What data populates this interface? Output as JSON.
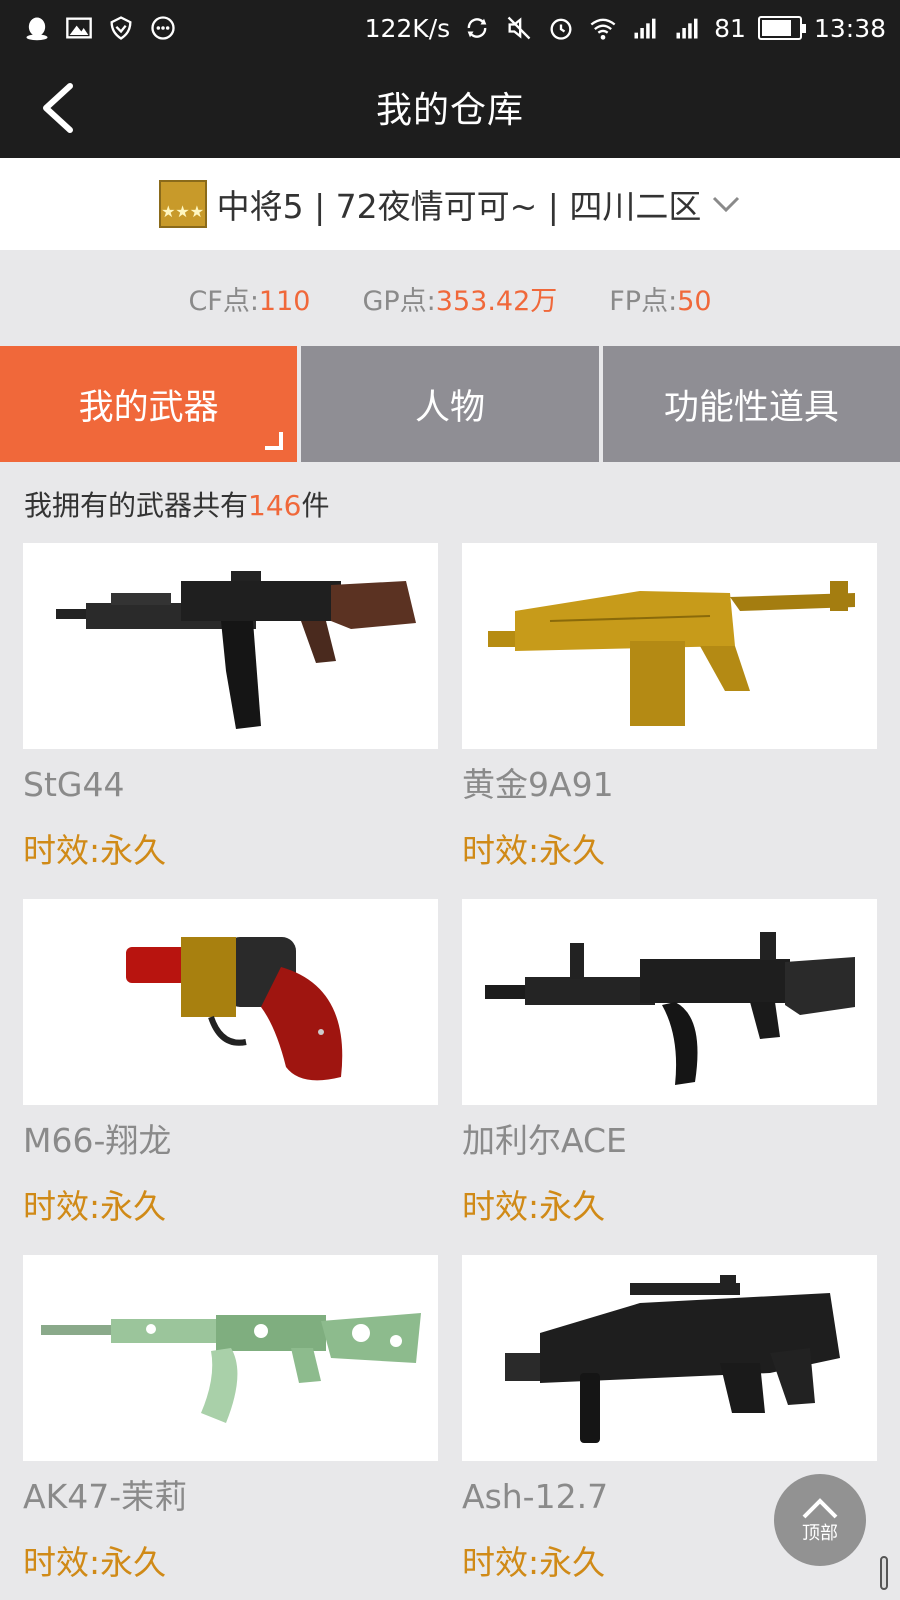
{
  "status_bar": {
    "net_speed": "122K/s",
    "battery_level": "81",
    "battery_fraction": 0.81,
    "time": "13:38",
    "left_icons": [
      "qq-icon",
      "gallery-icon",
      "shield-icon",
      "more-icon"
    ],
    "right_icons": [
      "sync-icon",
      "mute-icon",
      "alarm-icon",
      "wifi-icon",
      "signal-icon",
      "signal-icon-2"
    ]
  },
  "nav": {
    "title": "我的仓库",
    "back_icon": "back-arrow-icon"
  },
  "account": {
    "text": "中将5 | 72夜情可可~ | 四川二区",
    "badge_stars": "★★★",
    "dropdown_icon": "chevron-down-icon"
  },
  "points": {
    "cf_label": "CF点:",
    "cf_value": "110",
    "gp_label": "GP点:",
    "gp_value": "353.42万",
    "fp_label": "FP点:",
    "fp_value": "50"
  },
  "tabs": [
    {
      "label": "我的武器",
      "active": true
    },
    {
      "label": "人物",
      "active": false
    },
    {
      "label": "功能性道具",
      "active": false
    }
  ],
  "summary": {
    "prefix": "我拥有的武器共有",
    "count": "146",
    "suffix": "件"
  },
  "weapons": [
    {
      "name": "StG44",
      "duration": "时效:永久",
      "image": "rifle-brown-stock"
    },
    {
      "name": "黄金9A91",
      "duration": "时效:永久",
      "image": "gold-smg"
    },
    {
      "name": "M66-翔龙",
      "duration": "时效:永久",
      "image": "red-revolver"
    },
    {
      "name": "加利尔ACE",
      "duration": "时效:永久",
      "image": "black-rifle"
    },
    {
      "name": "AK47-茉莉",
      "duration": "时效:永久",
      "image": "green-floral-ak"
    },
    {
      "name": "Ash-12.7",
      "duration": "时效:永久",
      "image": "black-bullpup"
    }
  ],
  "to_top": {
    "label": "顶部"
  },
  "colors": {
    "accent": "#f0683a",
    "tab_inactive": "#8f8e94",
    "duration": "#d08a17",
    "header_bg": "#1d1d1d"
  }
}
